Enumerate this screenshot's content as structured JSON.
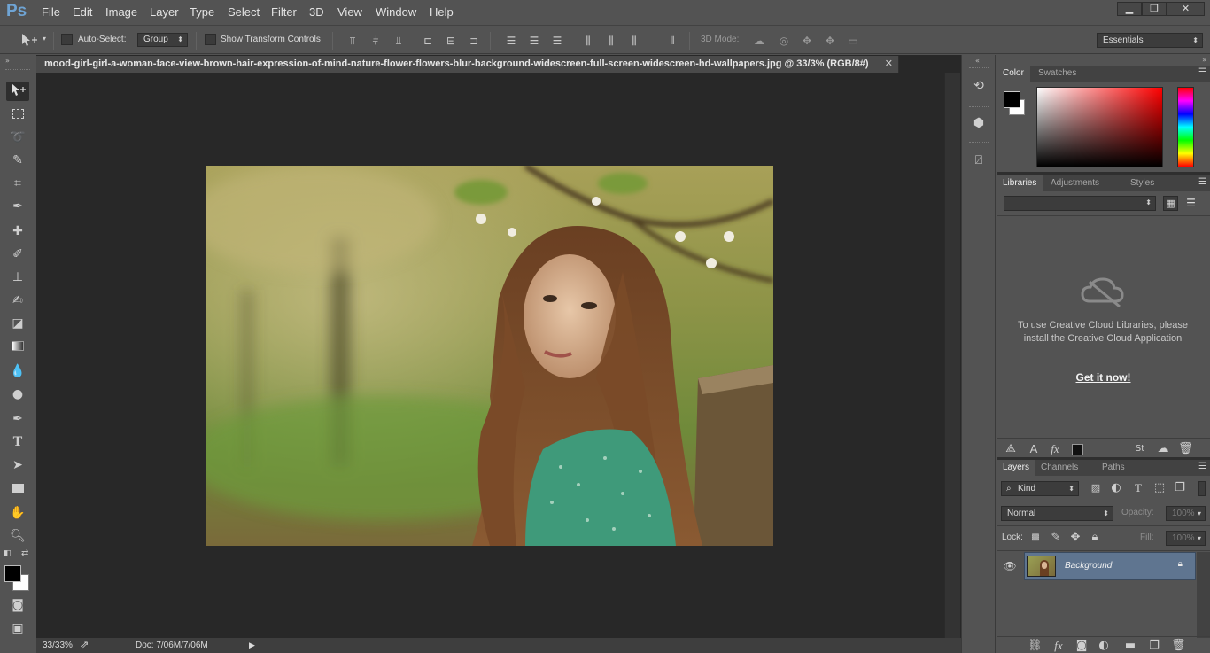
{
  "app": {
    "logo": "Ps"
  },
  "menu": [
    "File",
    "Edit",
    "Image",
    "Layer",
    "Type",
    "Select",
    "Filter",
    "3D",
    "View",
    "Window",
    "Help"
  ],
  "window_controls": {
    "minimize": "▁",
    "restore": "❐",
    "close": "✕"
  },
  "options_bar": {
    "auto_select_label": "Auto-Select:",
    "auto_select_target": "Group",
    "show_transform_label": "Show Transform Controls",
    "mode_3d_label": "3D Mode:",
    "workspace": "Essentials"
  },
  "document": {
    "tab_title": "mood-girl-girl-a-woman-face-view-brown-hair-expression-of-mind-nature-flower-flowers-blur-background-widescreen-full-screen-widescreen-hd-wallpapers.jpg @ 33/3% (RGB/8#)",
    "close_glyph": "✕"
  },
  "status_bar": {
    "zoom": "33/33%",
    "doc_size": "Doc: 7/06M/7/06M"
  },
  "color_panel": {
    "tabs": [
      "Color",
      "Swatches"
    ]
  },
  "libraries_panel": {
    "tabs": [
      "Libraries",
      "Adjustments",
      "Styles"
    ],
    "message": "To use Creative Cloud Libraries, please install the Creative Cloud Application",
    "cta": "Get it now!"
  },
  "layers_panel": {
    "tabs": [
      "Layers",
      "Channels",
      "Paths"
    ],
    "filter_kind": "Kind",
    "blend_mode": "Normal",
    "opacity_label": "Opacity:",
    "opacity_value": "100%",
    "lock_label": "Lock:",
    "fill_label": "Fill:",
    "fill_value": "100%",
    "layers": [
      {
        "name": "Background",
        "visible": true,
        "locked": true
      }
    ]
  },
  "colors": {
    "accent_blue": "#6fa4d4",
    "foreground": "#000000",
    "background": "#ffffff",
    "selected_layer": "#5f7590"
  }
}
